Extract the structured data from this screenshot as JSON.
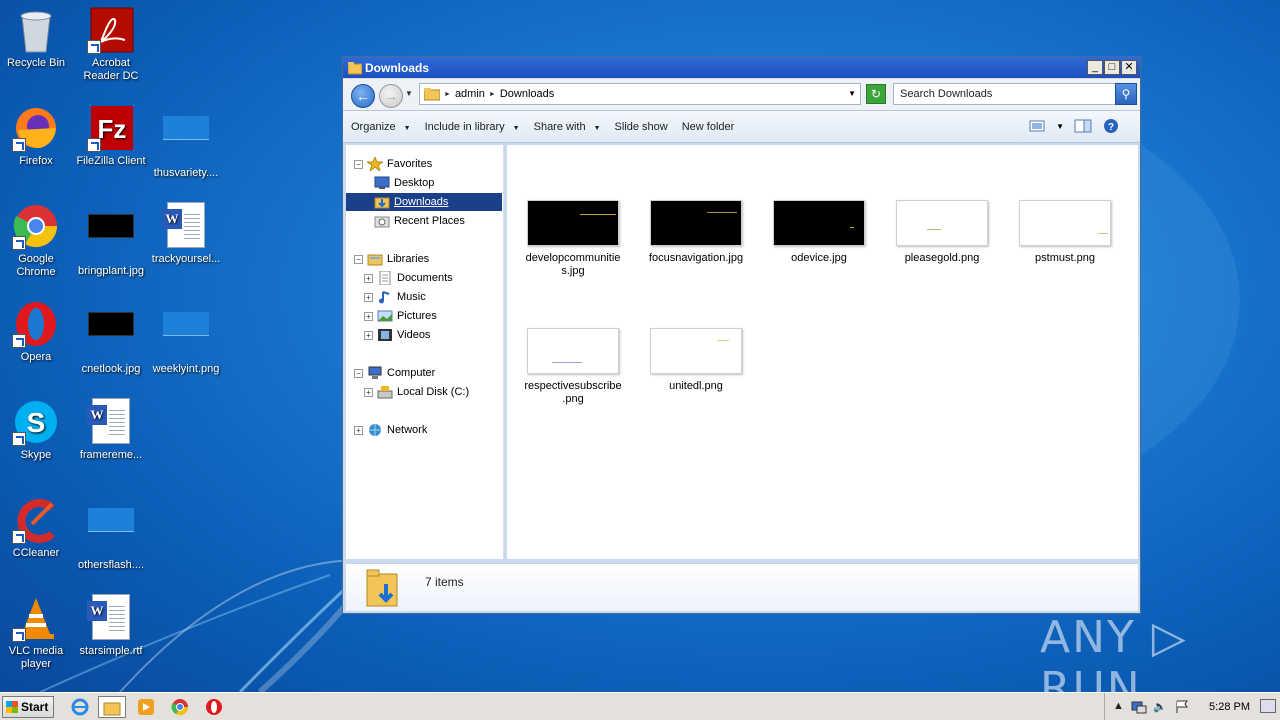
{
  "desktop": {
    "icons": [
      {
        "label": "Recycle Bin"
      },
      {
        "label": "Acrobat Reader DC"
      },
      {
        "label": "Firefox"
      },
      {
        "label": "FileZilla Client"
      },
      {
        "label": "thusvariety...."
      },
      {
        "label": "Google Chrome"
      },
      {
        "label": "bringplant.jpg"
      },
      {
        "label": "trackyoursel..."
      },
      {
        "label": "Opera"
      },
      {
        "label": "cnetlook.jpg"
      },
      {
        "label": "weeklyint.png"
      },
      {
        "label": "Skype"
      },
      {
        "label": "framereme..."
      },
      {
        "label": "CCleaner"
      },
      {
        "label": "othersflash...."
      },
      {
        "label": "VLC media player"
      },
      {
        "label": "starsimple.rtf"
      }
    ]
  },
  "window": {
    "title": "Downloads",
    "controls": {
      "minimize": "_",
      "maximize": "□",
      "close": "✕"
    },
    "address": {
      "crumbs": [
        "admin",
        "Downloads"
      ]
    },
    "search": {
      "placeholder": "Search Downloads"
    },
    "toolbar": {
      "organize": "Organize",
      "include_in_library": "Include in library",
      "share_with": "Share with",
      "slide_show": "Slide show",
      "new_folder": "New folder"
    },
    "nav": {
      "favorites": "Favorites",
      "desktop": "Desktop",
      "downloads": "Downloads",
      "recent_places": "Recent Places",
      "libraries": "Libraries",
      "documents": "Documents",
      "music": "Music",
      "pictures": "Pictures",
      "videos": "Videos",
      "computer": "Computer",
      "local_disk": "Local Disk (C:)",
      "network": "Network"
    },
    "files": [
      {
        "name": "developcommunities.jpg",
        "line1": "developcommunitie",
        "line2": "s.jpg"
      },
      {
        "name": "focusnavigation.jpg",
        "line1": "focusnavigation.jpg",
        "line2": ""
      },
      {
        "name": "odevice.jpg",
        "line1": "odevice.jpg",
        "line2": ""
      },
      {
        "name": "pleasegold.png",
        "line1": "pleasegold.png",
        "line2": ""
      },
      {
        "name": "pstmust.png",
        "line1": "pstmust.png",
        "line2": ""
      },
      {
        "name": "respectivesubscribe.png",
        "line1": "respectivesubscribe",
        "line2": ".png"
      },
      {
        "name": "unitedl.png",
        "line1": "unitedl.png",
        "line2": ""
      }
    ],
    "status": {
      "item_count": "7 items"
    }
  },
  "taskbar": {
    "start_label": "Start",
    "clock": "5:28 PM"
  },
  "watermark": "ANY ▷ RUN",
  "colors": {
    "accent": "#1c3f8a",
    "desktop_bg": "#1a78d0",
    "title_bar": "#2e6bd8"
  }
}
